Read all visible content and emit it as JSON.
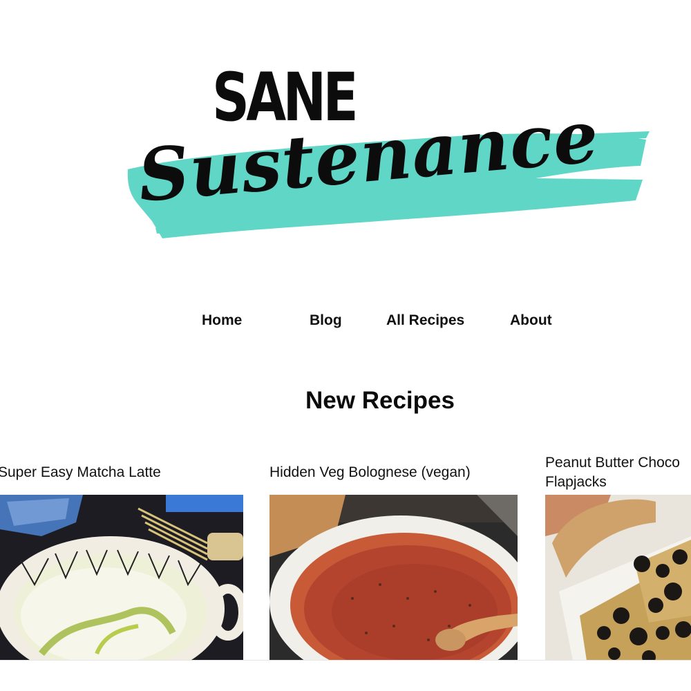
{
  "brand": {
    "top_word": "SANE",
    "script_word": "Sustenance",
    "accent_color": "#5fd6c6"
  },
  "nav": {
    "items": [
      {
        "label": "Home"
      },
      {
        "label": "Blog"
      },
      {
        "label": "All Recipes"
      },
      {
        "label": "About"
      }
    ]
  },
  "section": {
    "title": "New Recipes"
  },
  "recipes": [
    {
      "title_line1": "Super Easy Matcha Latte",
      "title_line2": "",
      "image_icon": "matcha-latte-photo"
    },
    {
      "title_line1": "Hidden Veg Bolognese (vegan)",
      "title_line2": "",
      "image_icon": "bolognese-photo"
    },
    {
      "title_line1": "Peanut Butter Choco",
      "title_line2": "Flapjacks",
      "image_icon": "flapjacks-photo"
    }
  ]
}
